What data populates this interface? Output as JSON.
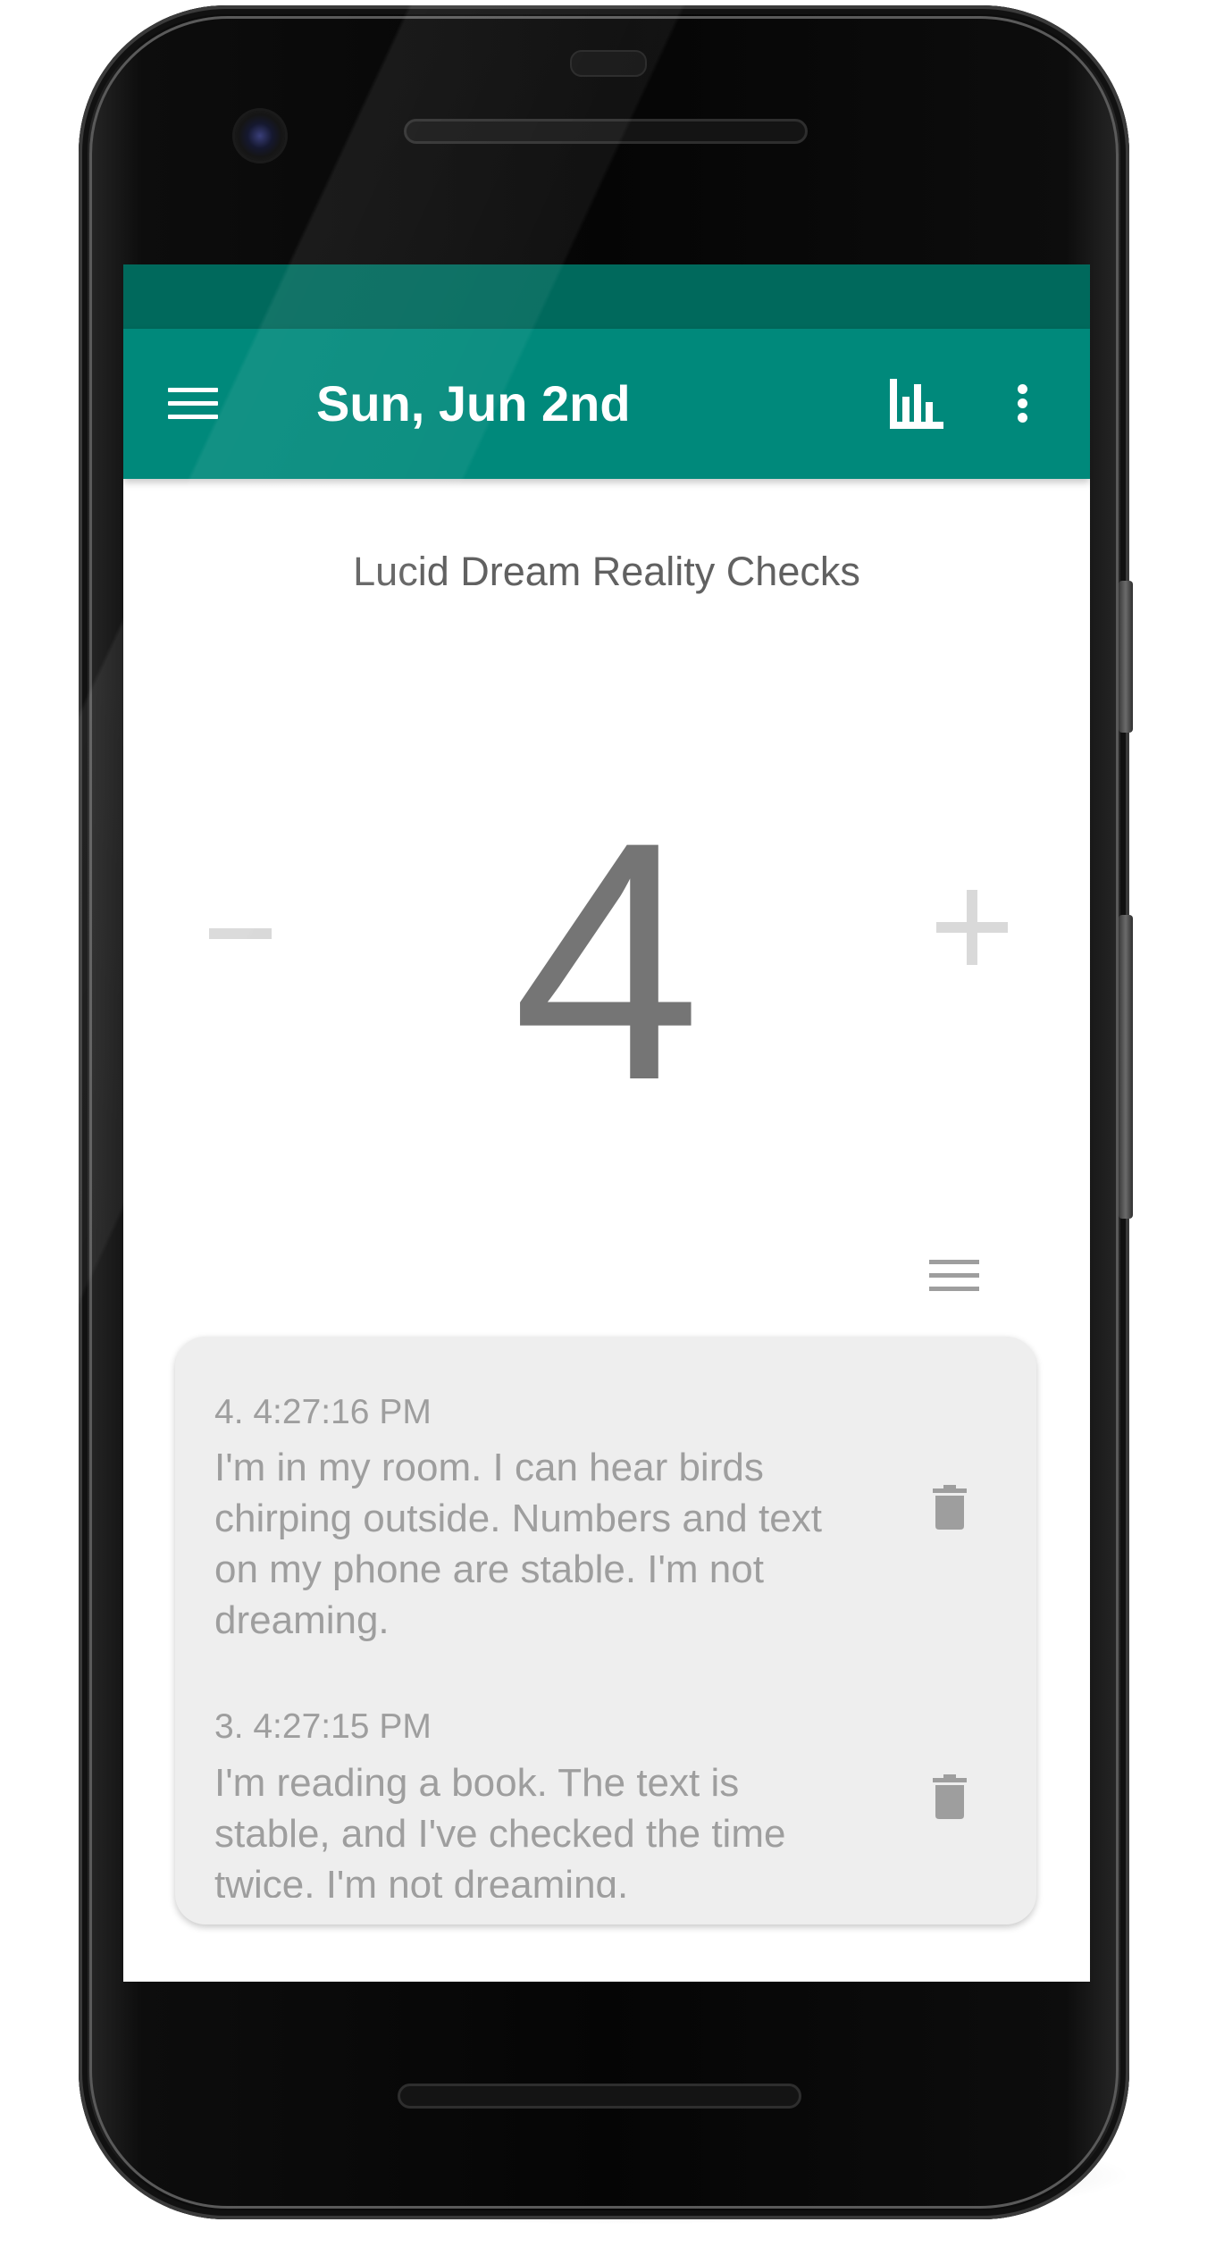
{
  "app_bar": {
    "title": "Sun, Jun 2nd",
    "color": "#00897b",
    "status_bar_color": "#00695c"
  },
  "counter": {
    "title": "Lucid Dream Reality Checks",
    "value": "4",
    "decrement_symbol": "minus-icon",
    "increment_symbol": "plus-icon"
  },
  "entries": [
    {
      "header": "4. 4:27:16 PM",
      "text": "I'm in my room. I can hear birds chirping outside. Numbers and text on my phone are stable. I'm not dreaming."
    },
    {
      "header": "3. 4:27:15 PM",
      "text": "I'm reading a book. The text is stable, and I've checked the time twice. I'm not dreaming."
    }
  ],
  "icons": {
    "menu": "menu-icon",
    "stats": "bar-chart-icon",
    "more": "more-vert-icon",
    "list": "list-icon",
    "delete": "trash-icon"
  }
}
